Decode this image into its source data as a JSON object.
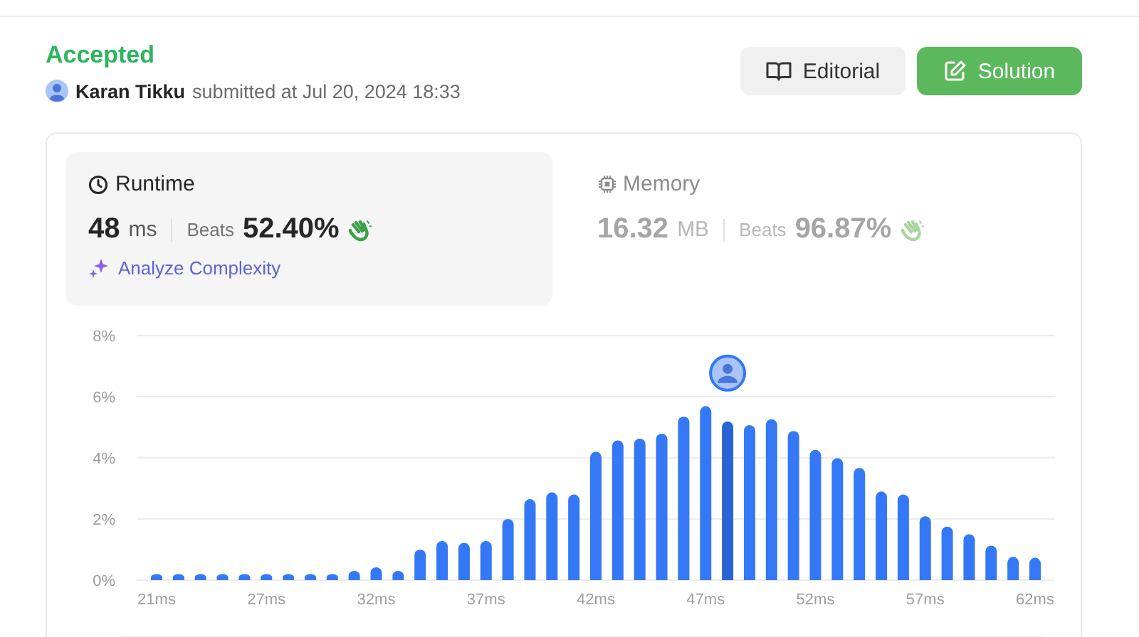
{
  "status": "Accepted",
  "submission": {
    "user": "Karan Tikku",
    "text": "submitted at Jul 20, 2024 18:33"
  },
  "buttons": [
    {
      "kind": "editorial",
      "label": "Editorial"
    },
    {
      "kind": "solution",
      "label": "Solution"
    }
  ],
  "metrics": [
    {
      "kind": "runtime",
      "label": "Runtime",
      "value": "48",
      "unit": "ms",
      "beats_label": "Beats",
      "beats": "52.40%",
      "selected": true,
      "action": "Analyze Complexity"
    },
    {
      "kind": "memory",
      "label": "Memory",
      "value": "16.32",
      "unit": "MB",
      "beats_label": "Beats",
      "beats": "96.87%",
      "selected": false
    }
  ],
  "chart_data": {
    "type": "bar",
    "categories": [
      "21ms",
      null,
      null,
      null,
      null,
      "27ms",
      null,
      null,
      null,
      null,
      "32ms",
      null,
      null,
      null,
      null,
      "37ms",
      null,
      null,
      null,
      null,
      "42ms",
      null,
      null,
      null,
      null,
      "47ms",
      null,
      null,
      null,
      null,
      "52ms",
      null,
      null,
      null,
      null,
      "57ms",
      null,
      null,
      null,
      null,
      "62ms"
    ],
    "series": [
      {
        "color": "#3478f6",
        "values": [
          0.2,
          0.2,
          0.2,
          0.2,
          0.2,
          0.2,
          0.2,
          0.2,
          0.2,
          0.3,
          0.42,
          0.3,
          1.0,
          1.28,
          1.22,
          1.28,
          2.0,
          2.65,
          2.87,
          2.8,
          4.2,
          4.57,
          4.63,
          4.79,
          5.35,
          5.69,
          null,
          5.07,
          5.26,
          4.88,
          4.26,
          3.99,
          3.67,
          2.9,
          2.8,
          2.09,
          1.75,
          1.5,
          1.13,
          0.76,
          0.73
        ]
      },
      {
        "color": "#2a64d6",
        "values": [
          null,
          null,
          null,
          null,
          null,
          null,
          null,
          null,
          null,
          null,
          null,
          null,
          null,
          null,
          null,
          null,
          null,
          null,
          null,
          null,
          null,
          null,
          null,
          null,
          null,
          null,
          5.19,
          null,
          null,
          null,
          null,
          null,
          null,
          null,
          null,
          null,
          null,
          null,
          null,
          null,
          null
        ]
      }
    ],
    "grid": true,
    "ylim": [
      0,
      8
    ],
    "yticks": [
      {
        "value": 0,
        "label": "0%"
      },
      {
        "value": 2,
        "label": "2%"
      },
      {
        "value": 4,
        "label": "4%"
      },
      {
        "value": 6,
        "label": "6%"
      },
      {
        "value": 8,
        "label": "8%"
      }
    ]
  }
}
